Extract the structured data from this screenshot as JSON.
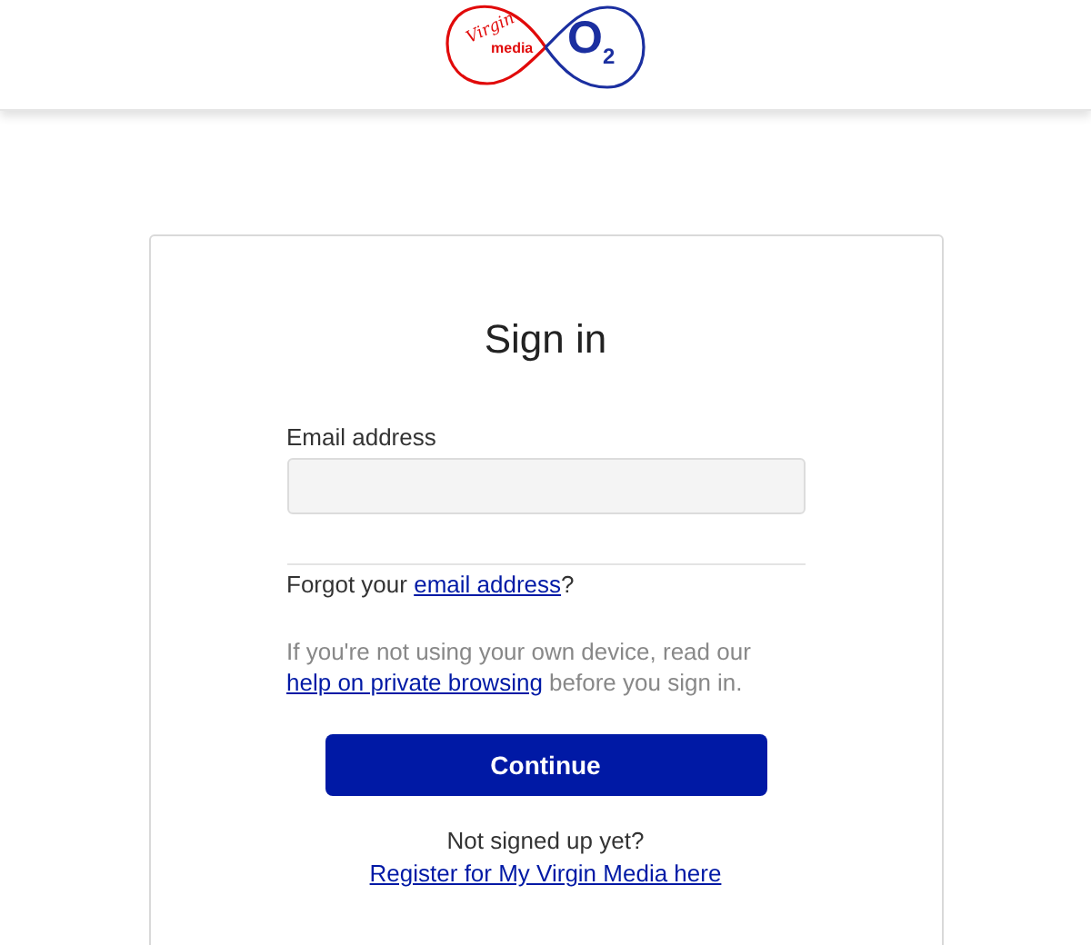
{
  "header": {
    "logo": {
      "left_word": "Virgin",
      "left_subword": "media",
      "right_word": "O$_{2}$"
    }
  },
  "card": {
    "title": "Sign in",
    "email": {
      "label": "Email address"
    },
    "forgot": {
      "text": "Forgot your ",
      "link": "email address",
      "after": "?"
    },
    "privacy_note": {
      "text": "If you're not using your own device, read our ",
      "link": "help on private browsing",
      "after": " before you sign in."
    },
    "continue_button": "Continue",
    "register": {
      "prompt": "Not signed up yet?",
      "link": "Register for My Virgin Media here"
    }
  }
}
